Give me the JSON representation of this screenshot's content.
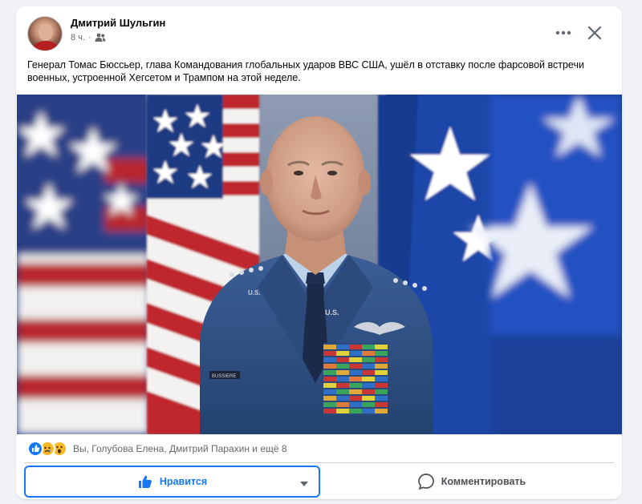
{
  "post": {
    "author": "Дмитрий Шульгин",
    "time": "8 ч.",
    "separator": "·",
    "audience_icon": "friends-icon",
    "text": "Генерал Томас Бюссьер, глава Командования глобальных ударов ВВС США, ушёл в отставку после фарсовой встречи военных, устроенной Хегсетом и Трампом на этой неделе."
  },
  "photo": {
    "nametag": "BUSSIERE",
    "insignia": "U.S."
  },
  "reactions": {
    "icons": [
      "like-icon",
      "sad-icon",
      "wow-icon"
    ],
    "summary": "Вы, Голубова Елена, Дмитрий Парахин и ещё 8"
  },
  "actions": {
    "like_label": "Нравится",
    "comment_label": "Комментировать"
  },
  "colors": {
    "accent": "#1877f2",
    "secondary_text": "#65676b",
    "flag_blue": "#1b3d8a",
    "flag_red": "#b22234"
  }
}
